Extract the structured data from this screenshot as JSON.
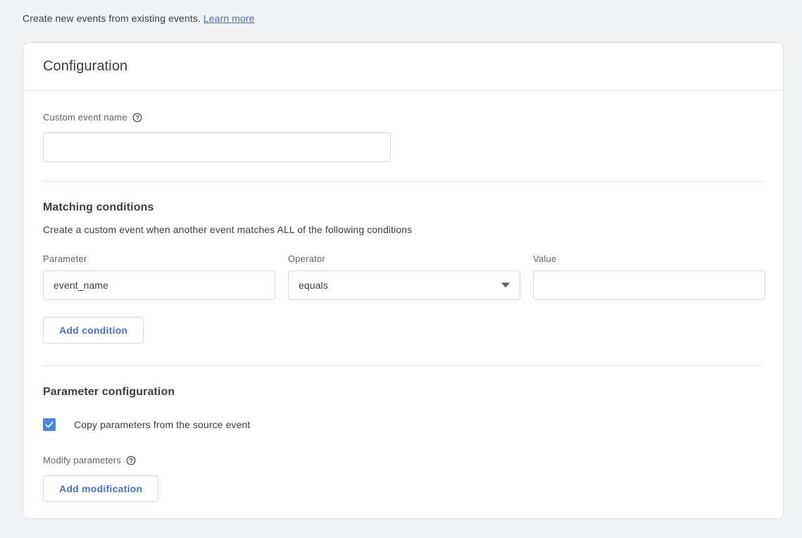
{
  "intro": {
    "text": "Create new events from existing events.",
    "link_label": "Learn more",
    "link_color": "#4a6ee0"
  },
  "card": {
    "header_title": "Configuration",
    "event_name": {
      "label": "Custom event name",
      "help_icon": "help-circle-icon",
      "value": "",
      "placeholder": ""
    },
    "matching_conditions": {
      "heading": "Matching conditions",
      "description": "Create a custom event when another event matches ALL of the following conditions",
      "columns": {
        "parameter": "Parameter",
        "operator": "Operator",
        "value": "Value"
      },
      "rows": [
        {
          "parameter": "event_name",
          "operator": "equals",
          "value": "",
          "operator_icon": "chevron-down-icon"
        }
      ],
      "add_condition_label": "Add condition"
    },
    "parameter_configuration": {
      "heading": "Parameter configuration",
      "copy_params": {
        "label": "Copy parameters from the source event",
        "checked": true,
        "accent_color": "#4285f4"
      },
      "modify_parameters": {
        "label": "Modify parameters",
        "help_icon": "help-circle-icon"
      },
      "add_modification_label": "Add modification"
    }
  }
}
